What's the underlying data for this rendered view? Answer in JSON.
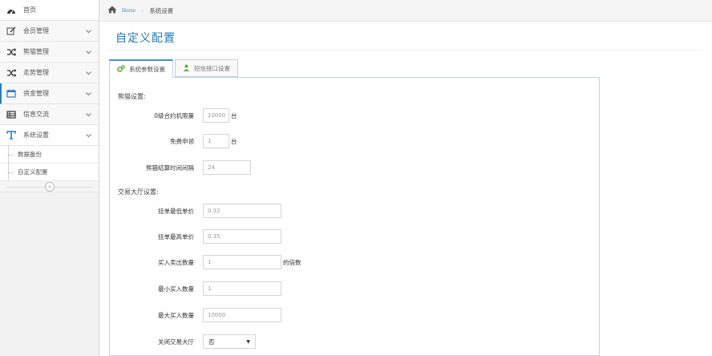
{
  "sidebar": {
    "items": [
      {
        "label": "首页",
        "icon": "dashboard-icon"
      },
      {
        "label": "会员管理",
        "icon": "edit-icon"
      },
      {
        "label": "熊猫管理",
        "icon": "shuffle-icon"
      },
      {
        "label": "走势管理",
        "icon": "shuffle-icon"
      },
      {
        "label": "资金管理",
        "icon": "calendar-icon"
      },
      {
        "label": "信息交流",
        "icon": "list-icon"
      },
      {
        "label": "系统设置",
        "icon": "text-icon"
      }
    ],
    "sub_items": [
      {
        "label": "数据备份"
      },
      {
        "label": "自定义配置"
      }
    ],
    "collapse_symbol": "«"
  },
  "breadcrumb": {
    "home": "Home",
    "current": "系统设置"
  },
  "page": {
    "title": "自定义配置"
  },
  "tabs": [
    {
      "label": "系统参数设置",
      "active": true
    },
    {
      "label": "短信接口设置",
      "active": false
    }
  ],
  "panda_section": {
    "title": "熊猫设置:",
    "fields": [
      {
        "label": "0级合约机限量",
        "value": "10000",
        "suffix": "台"
      },
      {
        "label": "免费申领",
        "value": "1",
        "suffix": "台"
      },
      {
        "label": "熊猫结算时间间隔",
        "value": "24",
        "suffix": ""
      }
    ]
  },
  "trade_section": {
    "title": "交易大厅设置:",
    "fields": [
      {
        "label": "挂单最低单价",
        "value": "0.32",
        "suffix": ""
      },
      {
        "label": "挂单最高单价",
        "value": "0.35",
        "suffix": ""
      },
      {
        "label": "买入卖出数量",
        "value": "1",
        "suffix": "的倍数"
      },
      {
        "label": "最小买入数量",
        "value": "1",
        "suffix": ""
      },
      {
        "label": "最大买入数量",
        "value": "10000",
        "suffix": ""
      }
    ],
    "close_hall": {
      "label": "关闭交易大厅",
      "value": "否"
    }
  },
  "colors": {
    "accent": "#2679b5",
    "link": "#4c8fbd",
    "tab_border": "#c5d0dc"
  }
}
